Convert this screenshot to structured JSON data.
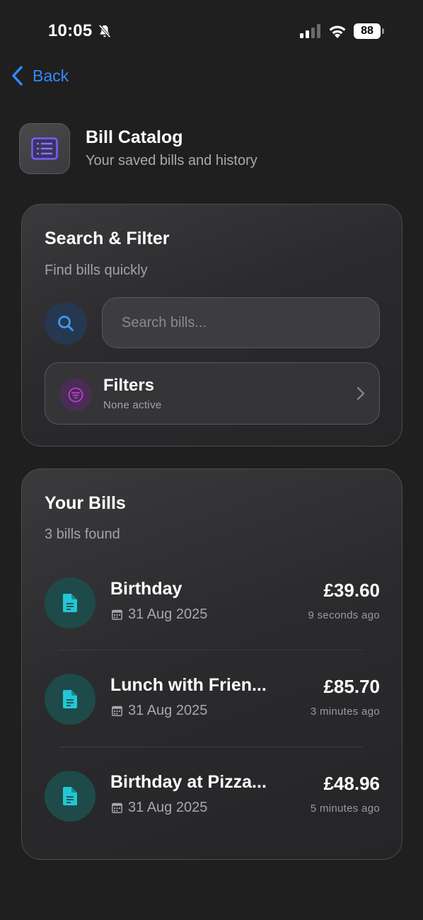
{
  "status_bar": {
    "time": "10:05",
    "battery": "88",
    "icons": [
      "bell-slash-icon",
      "cellular-signal-icon",
      "wifi-icon",
      "battery-icon"
    ]
  },
  "nav": {
    "back_label": "Back",
    "back_icon": "chevron-left-icon"
  },
  "header": {
    "title": "Bill Catalog",
    "subtitle": "Your saved bills and history",
    "icon": "list-icon"
  },
  "search_filter": {
    "title": "Search & Filter",
    "subtitle": "Find bills quickly",
    "search_placeholder": "Search bills...",
    "search_value": "",
    "filters_label": "Filters",
    "filters_status": "None active"
  },
  "bills": {
    "title": "Your Bills",
    "count_text": "3 bills found",
    "items": [
      {
        "name": "Birthday",
        "date": "31 Aug 2025",
        "amount": "£39.60",
        "ago": "9 seconds ago"
      },
      {
        "name": "Lunch with Frien...",
        "date": "31 Aug 2025",
        "amount": "£85.70",
        "ago": "3 minutes ago"
      },
      {
        "name": "Birthday at Pizza...",
        "date": "31 Aug 2025",
        "amount": "£48.96",
        "ago": "5 minutes ago"
      }
    ]
  },
  "colors": {
    "background": "#1f1f1f",
    "accent_blue": "#2f8cff",
    "filter_accent": "#c13bd6",
    "bill_icon": "#22c7d3",
    "app_icon": "#7a5cff"
  }
}
